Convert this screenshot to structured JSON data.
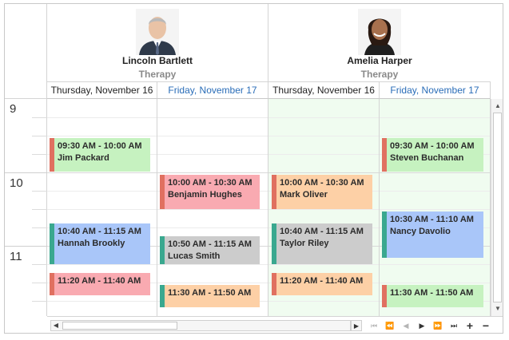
{
  "resources": [
    {
      "name": "Lincoln Bartlett",
      "group": "Therapy",
      "avatar_icon": "person-photo-icon"
    },
    {
      "name": "Amelia Harper",
      "group": "Therapy",
      "avatar_icon": "person-photo-icon"
    }
  ],
  "dates": [
    {
      "label": "Thursday, November 16"
    },
    {
      "label": "Friday, November 17"
    },
    {
      "label": "Thursday, November 16"
    },
    {
      "label": "Friday, November 17"
    }
  ],
  "hours": [
    "9",
    "10",
    "11"
  ],
  "appointments": [
    {
      "text": "09:30 AM - 10:00 AM Jim Packard",
      "color": "#c6f2c0",
      "bar": "#e07060"
    },
    {
      "text": "10:40 AM - 11:15 AM Hannah Brookly",
      "color": "#a9c6f9",
      "bar": "#3aa88f"
    },
    {
      "text": "11:20 AM - 11:40 AM",
      "color": "#f9aab1",
      "bar": "#e07060"
    },
    {
      "text": "10:00 AM - 10:30 AM Benjamin Hughes",
      "color": "#f9aab1",
      "bar": "#e07060"
    },
    {
      "text": "10:50 AM - 11:15 AM Lucas Smith",
      "color": "#cccccc",
      "bar": "#3aa88f"
    },
    {
      "text": "11:30 AM - 11:50 AM",
      "color": "#fdd0a6",
      "bar": "#3aa88f"
    },
    {
      "text": "10:00 AM - 10:30 AM Mark Oliver",
      "color": "#fdd0a6",
      "bar": "#e07060"
    },
    {
      "text": "10:40 AM - 11:15 AM Taylor Riley",
      "color": "#cccccc",
      "bar": "#3aa88f"
    },
    {
      "text": "11:20 AM - 11:40 AM",
      "color": "#fdd0a6",
      "bar": "#e07060"
    },
    {
      "text": "09:30 AM - 10:00 AM Steven Buchanan",
      "color": "#c6f2c0",
      "bar": "#e07060"
    },
    {
      "text": "10:30 AM - 11:10 AM Nancy Davolio",
      "color": "#a9c6f9",
      "bar": "#3aa88f"
    },
    {
      "text": "11:30 AM - 11:50 AM",
      "color": "#c6f2c0",
      "bar": "#e07060"
    }
  ],
  "scroll": {
    "up_icon": "arrow-up-icon",
    "down_icon": "arrow-down-icon",
    "left_icon": "arrow-left-icon",
    "right_icon": "arrow-right-icon"
  },
  "navigator": {
    "first": "first-page-icon",
    "prev_page": "prev-page-icon",
    "prev": "prev-icon",
    "next": "next-icon",
    "next_page": "next-page-icon",
    "last": "last-page-icon",
    "increase": "+",
    "decrease": "−"
  }
}
